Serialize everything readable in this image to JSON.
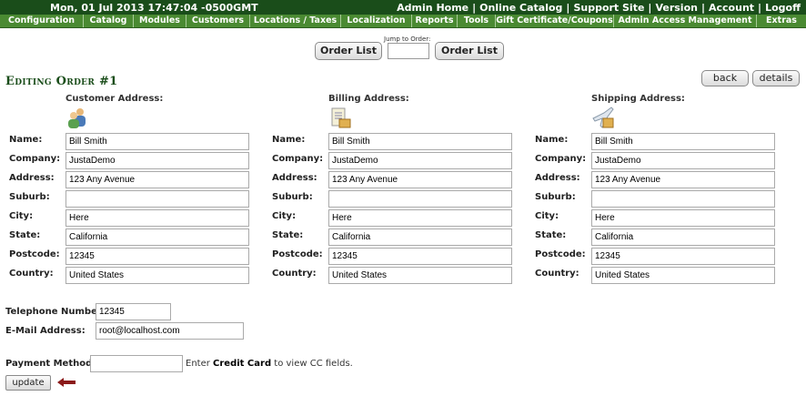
{
  "topbar": {
    "datetime": "Mon, 01 Jul 2013 17:47:04 -0500GMT",
    "links": [
      "Admin Home",
      "Online Catalog",
      "Support Site",
      "Version",
      "Account",
      "Logoff"
    ]
  },
  "menu": [
    "Configuration",
    "Catalog",
    "Modules",
    "Customers",
    "Locations / Taxes",
    "Localization",
    "Reports",
    "Tools",
    "Gift Certificate/Coupons",
    "Admin Access Management",
    "Extras"
  ],
  "toolbar": {
    "order_list_left": "Order List",
    "jump_label": "Jump to Order:",
    "jump_value": "",
    "order_list_right": "Order List",
    "back": "back",
    "details": "details"
  },
  "page_title": "Editing Order #1",
  "columns": [
    {
      "title": "Customer Address:",
      "icon": "customer-icon"
    },
    {
      "title": "Billing Address:",
      "icon": "billing-icon"
    },
    {
      "title": "Shipping Address:",
      "icon": "shipping-icon"
    }
  ],
  "field_labels": [
    "Name:",
    "Company:",
    "Address:",
    "Suburb:",
    "City:",
    "State:",
    "Postcode:",
    "Country:"
  ],
  "customer": [
    "Bill Smith",
    "JustaDemo",
    "123 Any Avenue",
    "",
    "Here",
    "California",
    "12345",
    "United States"
  ],
  "billing": [
    "Bill Smith",
    "JustaDemo",
    "123 Any Avenue",
    "",
    "Here",
    "California",
    "12345",
    "United States"
  ],
  "shipping": [
    "Bill Smith",
    "JustaDemo",
    "123 Any Avenue",
    "",
    "Here",
    "California",
    "12345",
    "United States"
  ],
  "contact": {
    "telephone_label": "Telephone Number:",
    "telephone": "12345",
    "email_label": "E-Mail Address:",
    "email": "root@localhost.com"
  },
  "payment": {
    "label": "Payment Method:",
    "value": "",
    "hint_prefix": "Enter",
    "hint_bold": "Credit Card",
    "hint_suffix": "to view CC fields."
  },
  "update_label": "update",
  "colors": {
    "topbar": "#1a4d1a",
    "menubar": "#4a8a32",
    "heading": "#1a4d1a",
    "arrow": "#8b1a1a"
  }
}
